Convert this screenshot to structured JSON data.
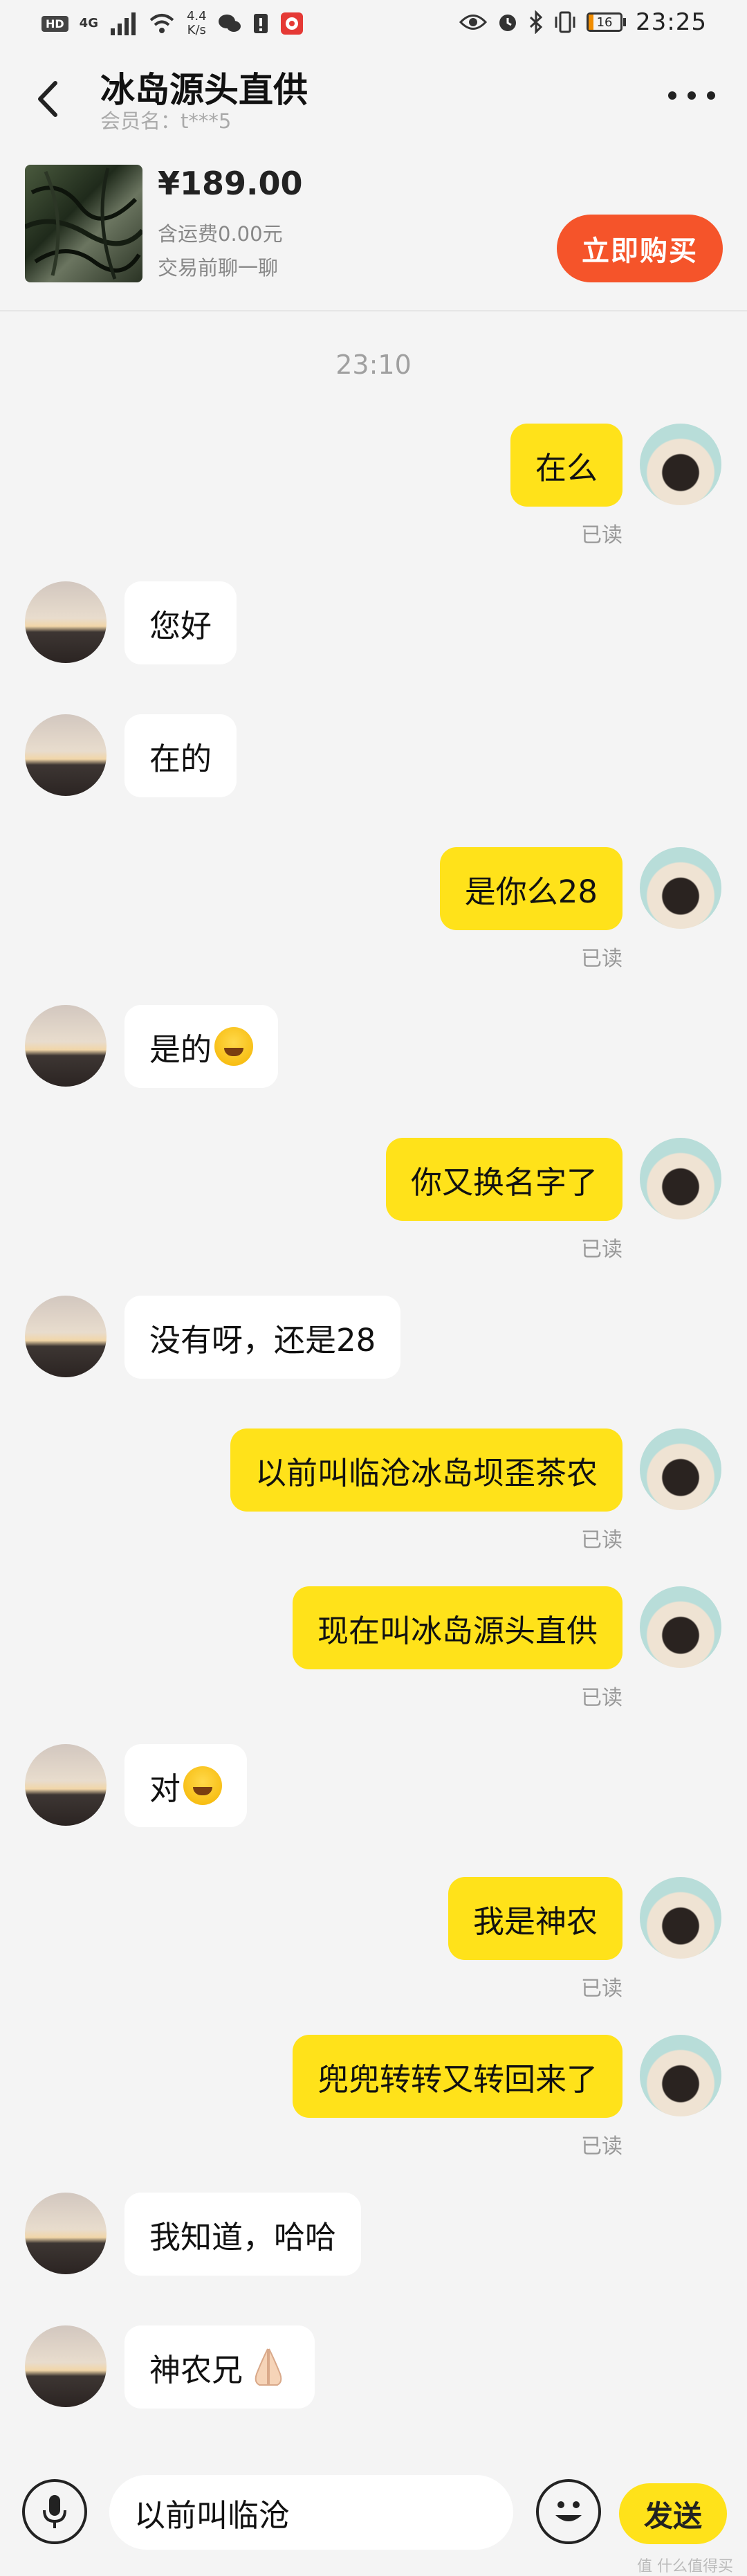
{
  "status_bar": {
    "hd": "HD",
    "net": "4G",
    "speed_value": "4.4",
    "speed_unit": "K/s",
    "battery": "16",
    "time": "23:25"
  },
  "header": {
    "title": "冰岛源头直供",
    "member": "会员名：t***5"
  },
  "product": {
    "price": "¥189.00",
    "shipping": "含运费0.00元",
    "chat_hint": "交易前聊一聊",
    "buy_label": "立即购买"
  },
  "chat": {
    "timestamp": "23:10",
    "read_label": "已读",
    "messages": [
      {
        "from": "me",
        "text": "在么"
      },
      {
        "from": "other",
        "text": "您好"
      },
      {
        "from": "other",
        "text": "在的"
      },
      {
        "from": "me",
        "text": "是你么28"
      },
      {
        "from": "other",
        "text": "是的"
      },
      {
        "from": "me",
        "text": "你又换名字了"
      },
      {
        "from": "other",
        "text": "没有呀，还是28"
      },
      {
        "from": "me",
        "text": "以前叫临沧冰岛坝歪茶农"
      },
      {
        "from": "me",
        "text": "现在叫冰岛源头直供"
      },
      {
        "from": "other",
        "text": "对"
      },
      {
        "from": "me",
        "text": "我是神农"
      },
      {
        "from": "me",
        "text": "兜兜转转又转回来了"
      },
      {
        "from": "other",
        "text": "我知道，哈哈"
      },
      {
        "from": "other",
        "text": "神农兄"
      }
    ]
  },
  "input": {
    "value": "以前叫临沧",
    "send_label": "发送"
  },
  "watermark": "值 什么值得买",
  "colors": {
    "my_bubble": "#ffe21a",
    "buy_button": "#f5542a",
    "background": "#f4f4f4"
  }
}
